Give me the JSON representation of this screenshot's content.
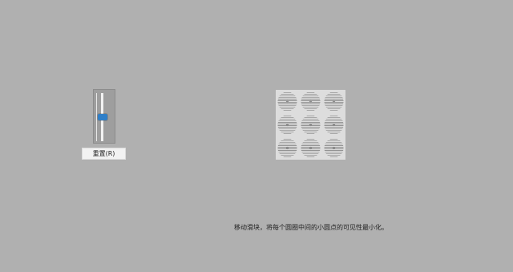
{
  "controls": {
    "reset_button_label": "重置(R)",
    "slider": {
      "value_fraction": 0.5,
      "thumb_color": "#2f7fc8"
    }
  },
  "stimulus": {
    "rows": 3,
    "cols": 3,
    "background_color": "#dddddd",
    "ring_color": "#8a8a8a"
  },
  "instruction": {
    "text": "移动滑块，将每个圆圈中间的小圆点的可见性最小化。"
  }
}
